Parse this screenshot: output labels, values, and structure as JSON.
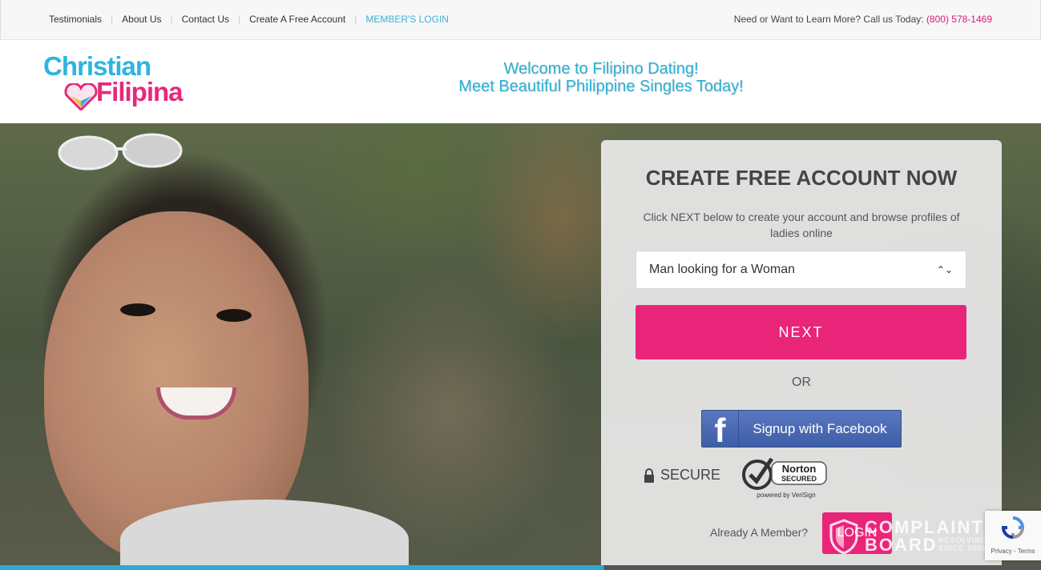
{
  "topnav": {
    "items": [
      "Testimonials",
      "About Us",
      "Contact Us",
      "Create A Free Account",
      "MEMBER'S LOGIN"
    ],
    "callus_text": "Need or Want to Learn More? Call us Today:",
    "phone": "(800) 578-1469"
  },
  "logo": {
    "line1": "Christian",
    "line2": "Filipina"
  },
  "header": {
    "welcome_line1": "Welcome to Filipino Dating!",
    "welcome_line2": "Meet Beautiful Philippine Singles Today!"
  },
  "signup": {
    "title": "CREATE FREE ACCOUNT NOW",
    "intro": "Click NEXT below to create your account and browse profiles of ladies online",
    "seeking_selected": "Man looking for a Woman",
    "next_label": "NEXT",
    "or_label": "OR",
    "facebook_label": "Signup with Facebook",
    "secure_label": "SECURE",
    "norton_line1": "Norton",
    "norton_line2": "SECURED",
    "norton_line3": "powered by VeriSign",
    "already_member": "Already A Member?",
    "login_label": "LOGIN"
  },
  "watermark": {
    "line1": "COMPLAINTS",
    "line2": "BOARD",
    "line3": "RESOLVING",
    "line4": "SINCE 2005"
  },
  "recaptcha": {
    "links": "Privacy - Terms"
  },
  "colors": {
    "brand_pink": "#e9257a",
    "brand_blue": "#2ab0d8"
  }
}
